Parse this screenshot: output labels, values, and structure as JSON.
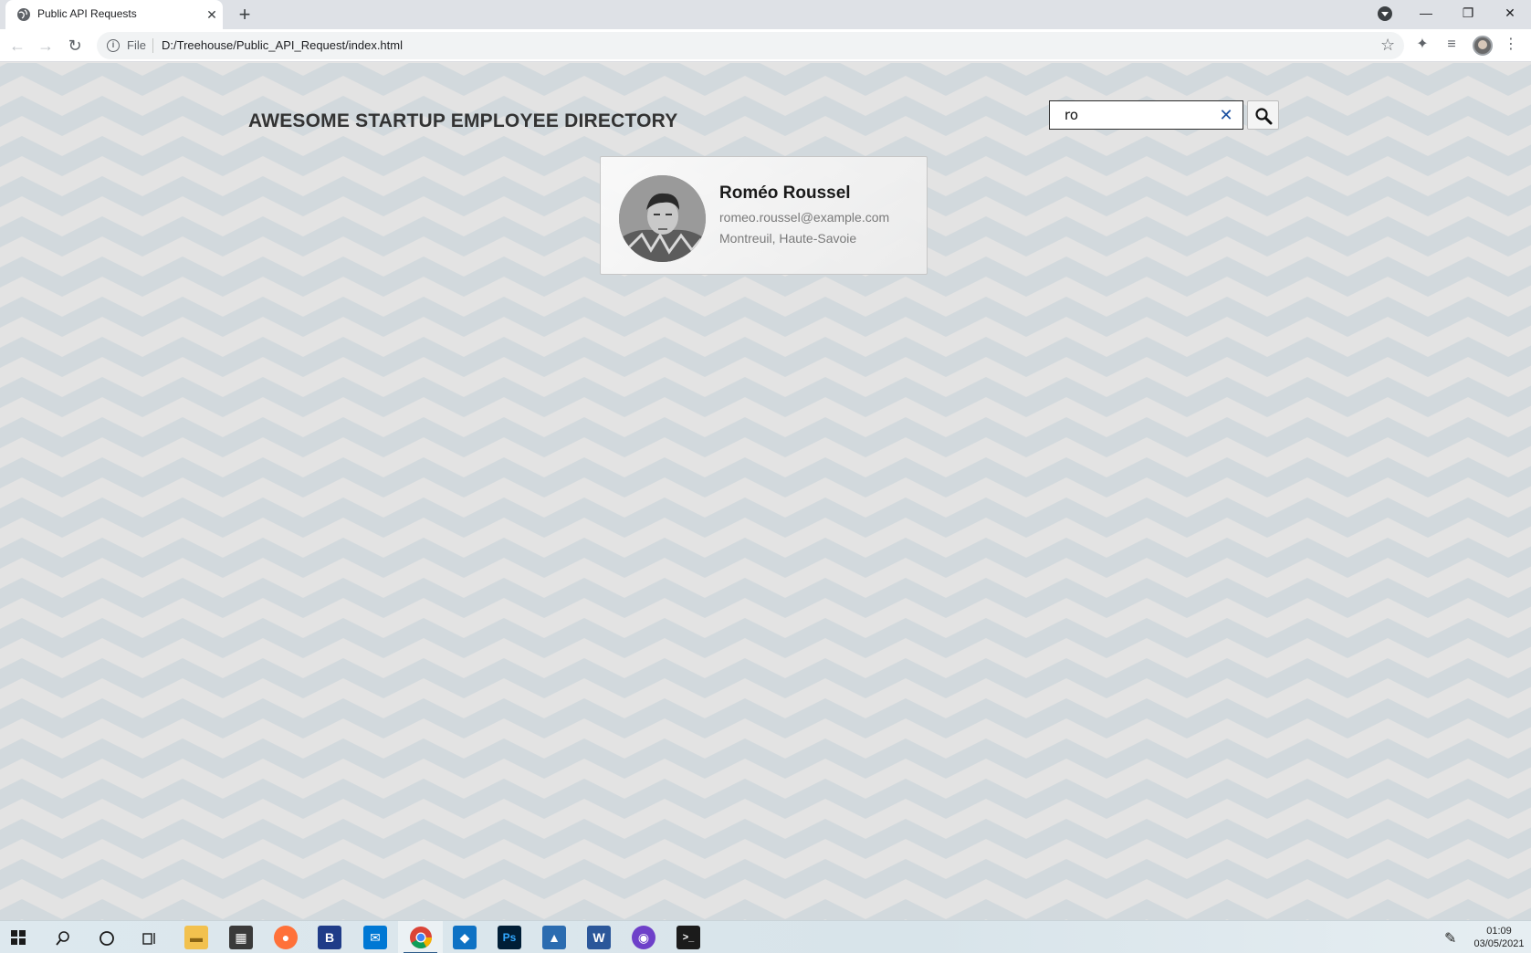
{
  "browser": {
    "tab_title": "Public API Requests",
    "url_scheme": "File",
    "url": "D:/Treehouse/Public_API_Request/index.html"
  },
  "page": {
    "title": "AWESOME STARTUP EMPLOYEE DIRECTORY",
    "search": {
      "value": "ro"
    },
    "employees": [
      {
        "name": "Roméo Roussel",
        "email": "romeo.roussel@example.com",
        "location": "Montreuil, Haute-Savoie"
      }
    ],
    "colors": {
      "background": "#e3e3e3",
      "chevron": "#d2d9dd",
      "clear_icon": "#1a4fa0"
    }
  },
  "taskbar": {
    "time": "01:09",
    "date": "03/05/2021",
    "apps": [
      "windows-start",
      "search",
      "cortana",
      "task-view",
      "file-explorer",
      "store",
      "firefox",
      "b-app",
      "mail",
      "chrome",
      "vscode",
      "photoshop",
      "photos",
      "word",
      "github-desktop",
      "terminal"
    ]
  }
}
